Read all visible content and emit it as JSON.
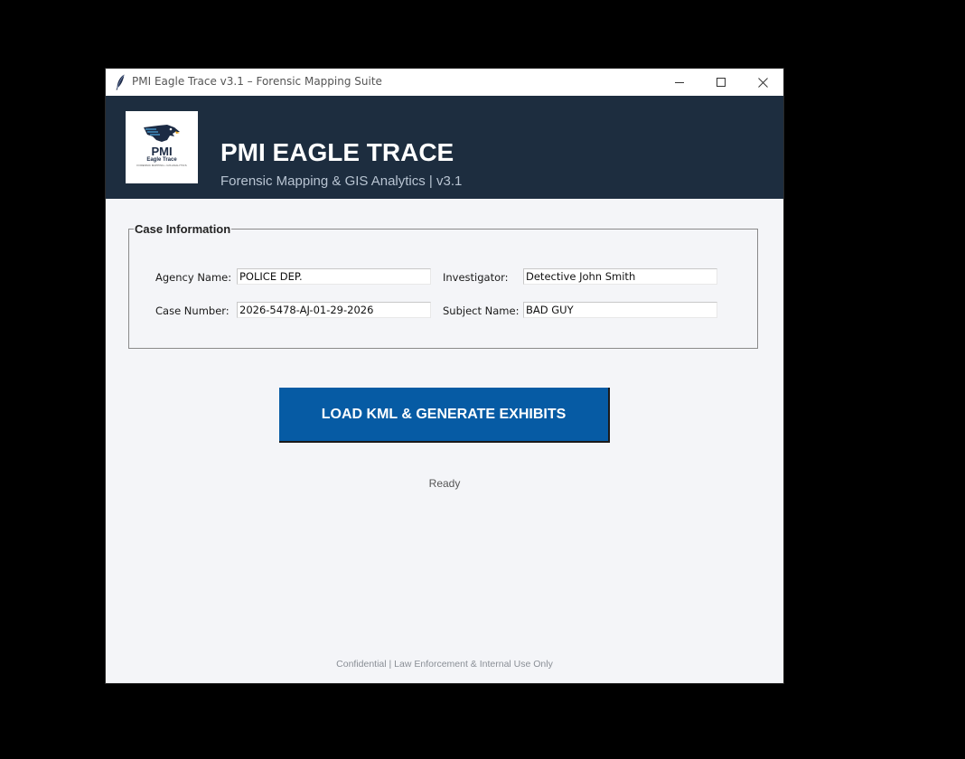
{
  "window": {
    "title": "PMI Eagle Trace v3.1 – Forensic Mapping Suite"
  },
  "header": {
    "logo": {
      "line1": "PMI",
      "line2": "Eagle Trace",
      "line3": "FORENSIC MAPPING • GIS ANALYTICS"
    },
    "title": "PMI EAGLE TRACE",
    "subtitle": "Forensic Mapping & GIS Analytics | v3.1"
  },
  "case_info": {
    "legend": "Case Information",
    "fields": [
      {
        "label": "Agency Name:",
        "value": "POLICE DEP."
      },
      {
        "label": "Investigator:",
        "value": "Detective John Smith"
      },
      {
        "label": "Case Number:",
        "value": "2026-5478-AJ-01-29-2026"
      },
      {
        "label": "Subject Name:",
        "value": "BAD GUY"
      }
    ]
  },
  "actions": {
    "load_button": "LOAD KML & GENERATE EXHIBITS"
  },
  "status": "Ready",
  "footer": "Confidential | Law Enforcement & Internal Use Only",
  "colors": {
    "header_bg": "#1d2d3f",
    "button_bg": "#065ba4",
    "window_bg": "#f4f5f8"
  }
}
